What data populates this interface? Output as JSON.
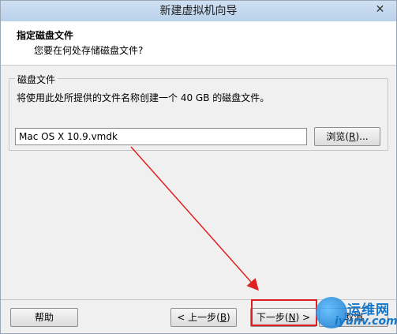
{
  "window": {
    "title": "新建虚拟机向导",
    "close_glyph": "✕"
  },
  "header": {
    "title": "指定磁盘文件",
    "subtitle": "您要在何处存储磁盘文件?"
  },
  "disk_group": {
    "label": "磁盘文件",
    "description": "将使用此处所提供的文件名称创建一个 40 GB 的磁盘文件。",
    "file_value": "Mac OS X 10.9.vmdk",
    "browse_label": "浏览",
    "browse_mnemonic": "R",
    "browse_suffix": ")..."
  },
  "footer": {
    "help_label": "帮助",
    "back_prefix": "< 上一步(",
    "back_mnemonic": "B",
    "back_suffix": ")",
    "next_prefix": "下一步(",
    "next_mnemonic": "N",
    "next_suffix": ") >",
    "cancel_label": "取消"
  },
  "watermark": {
    "line1": "运维网",
    "line2": "iyunv.com"
  },
  "colors": {
    "annotation_red": "#e02020",
    "watermark_blue": "#1677c9"
  }
}
